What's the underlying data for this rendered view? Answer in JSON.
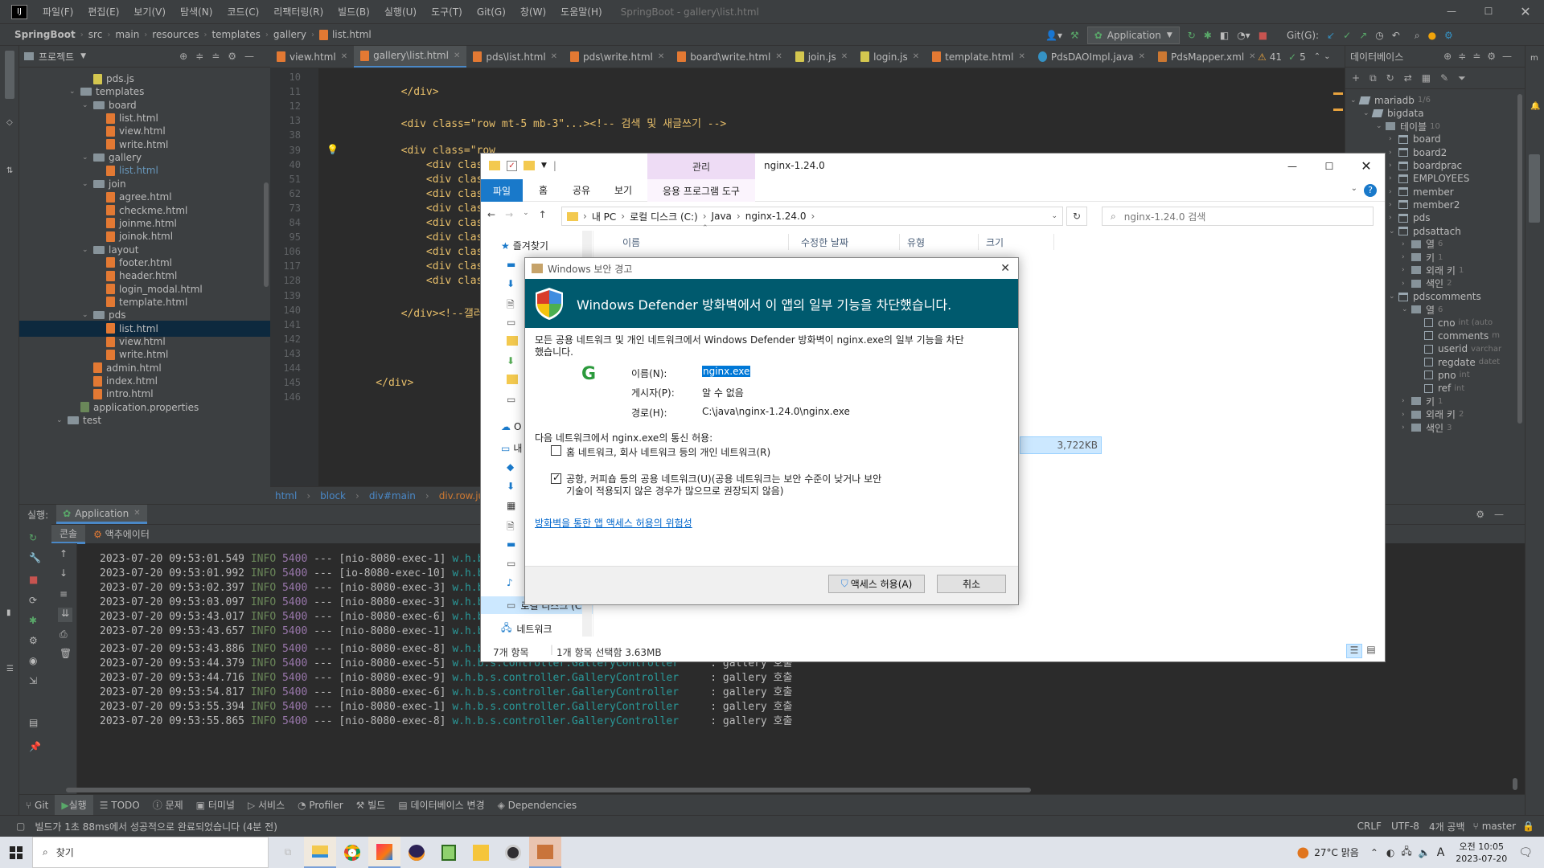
{
  "menubar": {
    "items": [
      "파일(F)",
      "편집(E)",
      "보기(V)",
      "탐색(N)",
      "코드(C)",
      "리팩터링(R)",
      "빌드(B)",
      "실행(U)",
      "도구(T)",
      "Git(G)",
      "창(W)",
      "도움말(H)"
    ],
    "window_title": "SpringBoot - gallery\\list.html"
  },
  "navbar": {
    "crumbs": [
      "SpringBoot",
      "src",
      "main",
      "resources",
      "templates",
      "gallery",
      "list.html"
    ],
    "run_config": "Application",
    "git_label": "Git(G):"
  },
  "project": {
    "title": "프로젝트",
    "tree": [
      {
        "label": "pds.js",
        "type": "js",
        "depth": 4
      },
      {
        "label": "templates",
        "type": "folder",
        "depth": 3,
        "open": true
      },
      {
        "label": "board",
        "type": "folder",
        "depth": 4,
        "open": true
      },
      {
        "label": "list.html",
        "type": "html",
        "depth": 5
      },
      {
        "label": "view.html",
        "type": "html",
        "depth": 5
      },
      {
        "label": "write.html",
        "type": "html",
        "depth": 5
      },
      {
        "label": "gallery",
        "type": "folder",
        "depth": 4,
        "open": true
      },
      {
        "label": "list.html",
        "type": "html",
        "depth": 5,
        "link": true
      },
      {
        "label": "join",
        "type": "folder",
        "depth": 4,
        "open": true
      },
      {
        "label": "agree.html",
        "type": "html",
        "depth": 5
      },
      {
        "label": "checkme.html",
        "type": "html",
        "depth": 5
      },
      {
        "label": "joinme.html",
        "type": "html",
        "depth": 5
      },
      {
        "label": "joinok.html",
        "type": "html",
        "depth": 5
      },
      {
        "label": "layout",
        "type": "folder",
        "depth": 4,
        "open": true
      },
      {
        "label": "footer.html",
        "type": "html",
        "depth": 5
      },
      {
        "label": "header.html",
        "type": "html",
        "depth": 5
      },
      {
        "label": "login_modal.html",
        "type": "html",
        "depth": 5
      },
      {
        "label": "template.html",
        "type": "html",
        "depth": 5
      },
      {
        "label": "pds",
        "type": "folder",
        "depth": 4,
        "open": true
      },
      {
        "label": "list.html",
        "type": "html",
        "depth": 5,
        "selected": true
      },
      {
        "label": "view.html",
        "type": "html",
        "depth": 5
      },
      {
        "label": "write.html",
        "type": "html",
        "depth": 5
      },
      {
        "label": "admin.html",
        "type": "html",
        "depth": 4
      },
      {
        "label": "index.html",
        "type": "html",
        "depth": 4
      },
      {
        "label": "intro.html",
        "type": "html",
        "depth": 4
      },
      {
        "label": "application.properties",
        "type": "prop",
        "depth": 3
      },
      {
        "label": "test",
        "type": "folder",
        "depth": 2,
        "open": true
      }
    ]
  },
  "tabs": [
    "view.html",
    "gallery\\list.html",
    "pds\\list.html",
    "pds\\write.html",
    "board\\write.html",
    "join.js",
    "login.js",
    "template.html",
    "PdsDAOImpl.java",
    "PdsMapper.xml"
  ],
  "active_tab": 1,
  "inspections": {
    "warnings": "41",
    "ok": "5"
  },
  "editor": {
    "lines": [
      {
        "n": "10",
        "code": ""
      },
      {
        "n": "11",
        "code": "        </div>"
      },
      {
        "n": "12",
        "code": ""
      },
      {
        "n": "13",
        "code": "        <div class=\"row mt-5 mb-3\"...><!-- 검색 및 새글쓰기 -->"
      },
      {
        "n": "38",
        "code": ""
      },
      {
        "n": "39",
        "code": "        <div class=\"row"
      },
      {
        "n": "40",
        "code": "            <div class="
      },
      {
        "n": "51",
        "code": "            <div class="
      },
      {
        "n": "62",
        "code": "            <div class="
      },
      {
        "n": "73",
        "code": "            <div class="
      },
      {
        "n": "84",
        "code": "            <div class="
      },
      {
        "n": "95",
        "code": "            <div class="
      },
      {
        "n": "106",
        "code": "            <div class="
      },
      {
        "n": "117",
        "code": "            <div class="
      },
      {
        "n": "128",
        "code": "            <div class="
      },
      {
        "n": "139",
        "code": ""
      },
      {
        "n": "140",
        "code": "        </div><!--갤러리"
      },
      {
        "n": "141",
        "code": ""
      },
      {
        "n": "142",
        "code": ""
      },
      {
        "n": "143",
        "code": ""
      },
      {
        "n": "144",
        "code": ""
      },
      {
        "n": "145",
        "code": "    </div>"
      },
      {
        "n": "146",
        "code": ""
      }
    ],
    "crumbs": [
      "html",
      "block",
      "div#main",
      "div.row.justify"
    ]
  },
  "database": {
    "title": "데이터베이스",
    "items": [
      {
        "label": "mariadb",
        "extra": "1/6",
        "depth": 0,
        "kind": "ds"
      },
      {
        "label": "bigdata",
        "extra": "",
        "depth": 1,
        "kind": "schema"
      },
      {
        "label": "테이블",
        "extra": "10",
        "depth": 2,
        "kind": "folder"
      },
      {
        "label": "board",
        "extra": "",
        "depth": 3,
        "kind": "table"
      },
      {
        "label": "board2",
        "extra": "",
        "depth": 3,
        "kind": "table"
      },
      {
        "label": "boardprac",
        "extra": "",
        "depth": 3,
        "kind": "table"
      },
      {
        "label": "EMPLOYEES",
        "extra": "",
        "depth": 3,
        "kind": "table"
      },
      {
        "label": "member",
        "extra": "",
        "depth": 3,
        "kind": "table"
      },
      {
        "label": "member2",
        "extra": "",
        "depth": 3,
        "kind": "table"
      },
      {
        "label": "pds",
        "extra": "",
        "depth": 3,
        "kind": "table"
      },
      {
        "label": "pdsattach",
        "extra": "",
        "depth": 3,
        "kind": "table"
      },
      {
        "label": "열",
        "extra": "6",
        "depth": 4,
        "kind": "folder"
      },
      {
        "label": "키",
        "extra": "1",
        "depth": 4,
        "kind": "folder"
      },
      {
        "label": "외래 키",
        "extra": "1",
        "depth": 4,
        "kind": "folder"
      },
      {
        "label": "색인",
        "extra": "2",
        "depth": 4,
        "kind": "folder"
      },
      {
        "label": "pdscomments",
        "extra": "",
        "depth": 3,
        "kind": "table"
      },
      {
        "label": "열",
        "extra": "6",
        "depth": 4,
        "kind": "folder"
      },
      {
        "label": "cno",
        "extra": "int (auto",
        "depth": 5,
        "kind": "col"
      },
      {
        "label": "comments",
        "extra": "m",
        "depth": 5,
        "kind": "col"
      },
      {
        "label": "userid",
        "extra": "varchar",
        "depth": 5,
        "kind": "col"
      },
      {
        "label": "regdate",
        "extra": "datet",
        "depth": 5,
        "kind": "col"
      },
      {
        "label": "pno",
        "extra": "int",
        "depth": 5,
        "kind": "col"
      },
      {
        "label": "ref",
        "extra": "int",
        "depth": 5,
        "kind": "col"
      },
      {
        "label": "키",
        "extra": "1",
        "depth": 4,
        "kind": "folder"
      },
      {
        "label": "외래 키",
        "extra": "2",
        "depth": 4,
        "kind": "folder"
      },
      {
        "label": "색인",
        "extra": "3",
        "depth": 4,
        "kind": "folder"
      }
    ]
  },
  "run": {
    "label": "실행:",
    "config": "Application",
    "tabs": [
      "콘솔",
      "액추에이터"
    ],
    "logs": [
      {
        "ts": "2023-07-20 09:53:01.549",
        "lvl": "INFO",
        "pid": "5400",
        "thread": "--- [nio-8080-exec-1]",
        "cls": "w.h.b",
        "msg": ""
      },
      {
        "ts": "2023-07-20 09:53:01.992",
        "lvl": "INFO",
        "pid": "5400",
        "thread": "--- [io-8080-exec-10]",
        "cls": "w.h.b",
        "msg": ""
      },
      {
        "ts": "2023-07-20 09:53:02.397",
        "lvl": "INFO",
        "pid": "5400",
        "thread": "--- [nio-8080-exec-3]",
        "cls": "w.h.b",
        "msg": ""
      },
      {
        "ts": "2023-07-20 09:53:03.097",
        "lvl": "INFO",
        "pid": "5400",
        "thread": "--- [nio-8080-exec-3]",
        "cls": "w.h.b",
        "msg": ""
      },
      {
        "ts": "2023-07-20 09:53:43.017",
        "lvl": "INFO",
        "pid": "5400",
        "thread": "--- [nio-8080-exec-6]",
        "cls": "w.h.b",
        "msg": ""
      },
      {
        "ts": "2023-07-20 09:53:43.657",
        "lvl": "INFO",
        "pid": "5400",
        "thread": "--- [nio-8080-exec-1]",
        "cls": "w.h.b",
        "msg": ""
      },
      {
        "ts": "2023-07-20 09:53:43.886",
        "lvl": "INFO",
        "pid": "5400",
        "thread": "--- [nio-8080-exec-8]",
        "cls": "w.h.b.s.controller.GalleryController",
        "msg": ": gallery 호출"
      },
      {
        "ts": "2023-07-20 09:53:44.379",
        "lvl": "INFO",
        "pid": "5400",
        "thread": "--- [nio-8080-exec-5]",
        "cls": "w.h.b.s.controller.GalleryController",
        "msg": ": gallery 호출"
      },
      {
        "ts": "2023-07-20 09:53:44.716",
        "lvl": "INFO",
        "pid": "5400",
        "thread": "--- [nio-8080-exec-9]",
        "cls": "w.h.b.s.controller.GalleryController",
        "msg": ": gallery 호출"
      },
      {
        "ts": "2023-07-20 09:53:54.817",
        "lvl": "INFO",
        "pid": "5400",
        "thread": "--- [nio-8080-exec-6]",
        "cls": "w.h.b.s.controller.GalleryController",
        "msg": ": gallery 호출"
      },
      {
        "ts": "2023-07-20 09:53:55.394",
        "lvl": "INFO",
        "pid": "5400",
        "thread": "--- [nio-8080-exec-1]",
        "cls": "w.h.b.s.controller.GalleryController",
        "msg": ": gallery 호출"
      },
      {
        "ts": "2023-07-20 09:53:55.865",
        "lvl": "INFO",
        "pid": "5400",
        "thread": "--- [nio-8080-exec-8]",
        "cls": "w.h.b.s.controller.GalleryController",
        "msg": ": gallery 호출"
      }
    ]
  },
  "bottom_tools": [
    "Git",
    "실행",
    "TODO",
    "문제",
    "터미널",
    "서비스",
    "Profiler",
    "빌드",
    "데이터베이스 변경",
    "Dependencies"
  ],
  "status": {
    "message": "빌드가 1초 88ms에서 성공적으로 완료되었습니다 (4분 전)",
    "line_sep": "CRLF",
    "encoding": "UTF-8",
    "indent": "4개 공백",
    "branch": "master"
  },
  "explorer": {
    "title": "nginx-1.24.0",
    "manage_label": "관리",
    "ribbon_tabs": [
      "파일",
      "홈",
      "공유",
      "보기",
      "응용 프로그램 도구"
    ],
    "path": [
      "내 PC",
      "로컬 디스크 (C:)",
      "Java",
      "nginx-1.24.0"
    ],
    "search_placeholder": "nginx-1.24.0 검색",
    "columns": [
      "이름",
      "수정한 날짜",
      "유형",
      "크기"
    ],
    "selected_size": "3,722KB",
    "sidebar": [
      "즐겨찾기",
      "로컬 디스크 (C:)",
      "네트워크"
    ],
    "sidebar_partial": [
      "O",
      "내"
    ],
    "item_count": "7개 항목",
    "selection": "1개 항목 선택함 3.63MB"
  },
  "dialog": {
    "title": "Windows 보안 경고",
    "banner": "Windows Defender 방화벽에서 이 앱의 일부 기능을 차단했습니다.",
    "body": "모든 공용 네트워크 및 개인 네트워크에서 Windows Defender 방화벽이 nginx.exe의 일부 기능을 차단했습니다.",
    "name_label": "이름(N):",
    "name_value": "nginx.exe",
    "publisher_label": "게시자(P):",
    "publisher_value": "알 수 없음",
    "path_label": "경로(H):",
    "path_value": "C:\\java\\nginx-1.24.0\\nginx.exe",
    "allow_prompt": "다음 네트워크에서 nginx.exe의 통신 허용:",
    "private_label": "홈 네트워크, 회사 네트워크 등의 개인 네트워크(R)",
    "private_checked": false,
    "public_label": "공항, 커피숍 등의 공용 네트워크(U)(공용 네트워크는 보안 수준이 낮거나 보안 기술이 적용되지 않은 경우가 많으므로 권장되지 않음)",
    "public_checked": true,
    "risk_link": "방화벽을 통한 앱 액세스 허용의 위험성",
    "allow_button": "액세스 허용(A)",
    "cancel_button": "취소"
  },
  "taskbar": {
    "search_placeholder": "찾기",
    "weather": "27°C 맑음",
    "ime": "A",
    "time": "오전 10:05",
    "date": "2023-07-20"
  },
  "colors": {
    "ide_bg": "#2b2b2b",
    "panel_bg": "#3c3f41",
    "accent": "#4a88c7",
    "banner": "#005a6e",
    "link": "#0066cc"
  }
}
